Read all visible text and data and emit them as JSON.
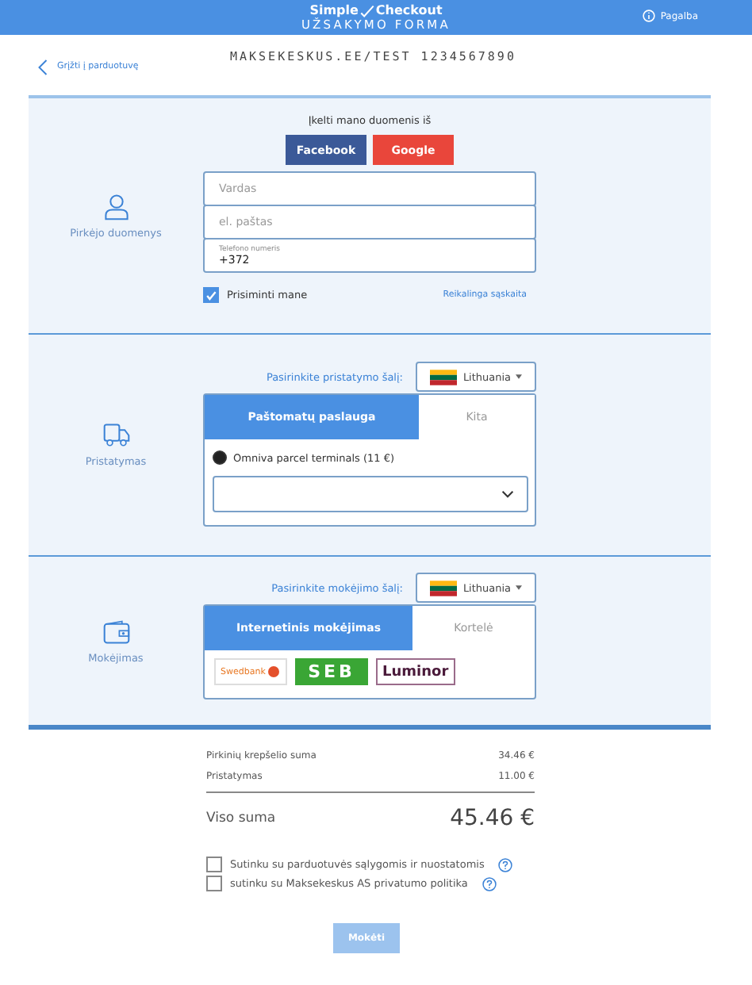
{
  "header": {
    "brand_left": "Simple",
    "brand_right": "Checkout",
    "title": "UŽSAKYMO FORMA",
    "help": "Pagalba"
  },
  "back_link": "Grįžti į parduotuvę",
  "merchant": "MAKSEKESKUS.EE/TEST 1234567890",
  "buyer": {
    "label": "Pirkėjo duomenys",
    "import_text": "Įkelti mano duomenis iš",
    "social": [
      {
        "label": "Facebook",
        "color": "#3b5998"
      },
      {
        "label": "Google",
        "color": "#e9463b"
      }
    ],
    "fields": [
      {
        "kind": "plain",
        "placeholder": "Vardas"
      },
      {
        "kind": "plain",
        "placeholder": "el. paštas"
      },
      {
        "kind": "labeled",
        "label": "Telefono numeris",
        "value": "+372"
      }
    ],
    "remember": {
      "label": "Prisiminti mane",
      "checked": true
    },
    "required_note": "Reikalinga sąskaita"
  },
  "delivery": {
    "label": "Pristatymas",
    "country_prompt": "Pasirinkite pristatymo šalį:",
    "country": "Lithuania",
    "tabs": [
      {
        "label": "Paštomatų paslauga",
        "selected": true
      },
      {
        "label": "Kita",
        "selected": false
      }
    ],
    "option": {
      "label": "Omniva parcel terminals (11 €)",
      "selected": true
    }
  },
  "payment": {
    "label": "Mokėjimas",
    "country_prompt": "Pasirinkite mokėjimo šalį:",
    "country": "Lithuania",
    "tabs": [
      {
        "label": "Internetinis mokėjimas",
        "selected": true
      },
      {
        "label": "Kortelė",
        "selected": false
      }
    ],
    "banks": [
      {
        "kind": "swedbank",
        "label": "Swedbank"
      },
      {
        "kind": "seb",
        "label": "SEB"
      },
      {
        "kind": "luminor",
        "label": "Luminor"
      }
    ]
  },
  "summary": {
    "rows": [
      {
        "label": "Pirkinių krepšelio suma",
        "value": "34.46 €"
      },
      {
        "label": "Pristatymas",
        "value": "11.00 €"
      }
    ],
    "total_label": "Viso suma",
    "total_value": "45.46 €"
  },
  "agreements": [
    {
      "label": "Sutinku su parduotuvės sąlygomis ir nuostatomis",
      "checked": false
    },
    {
      "label": "sutinku su Maksekeskus AS privatumo politika",
      "checked": false
    }
  ],
  "pay_button": {
    "label": "Mokėti",
    "disabled": true
  }
}
